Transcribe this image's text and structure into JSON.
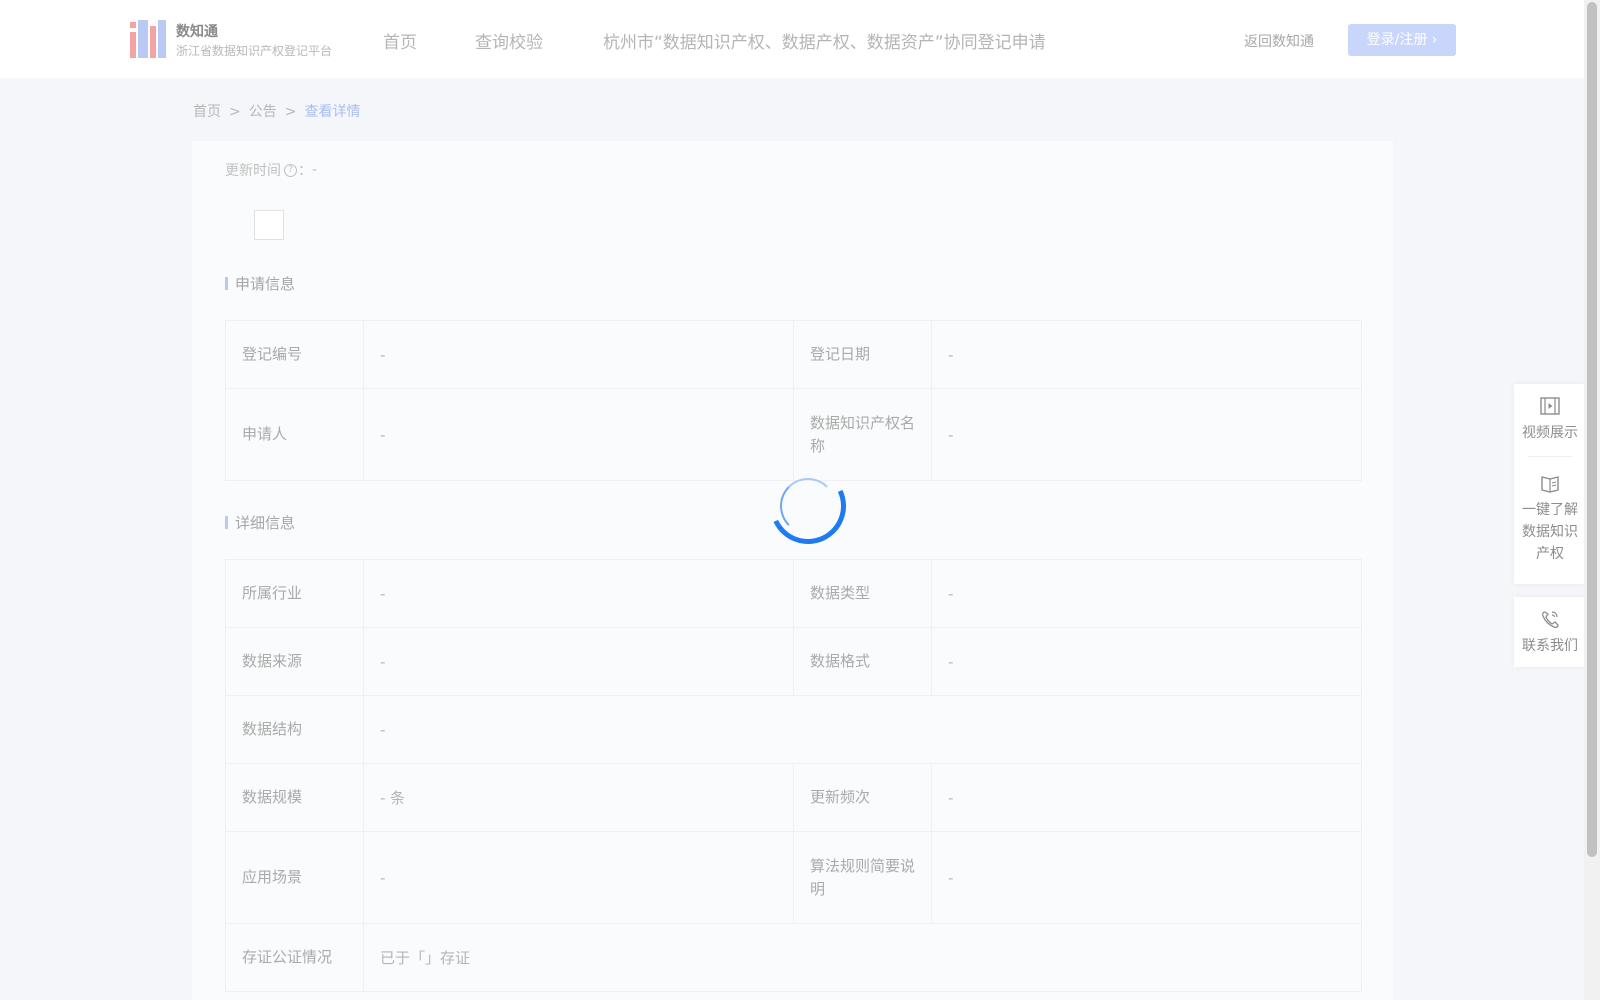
{
  "header": {
    "brand_name": "数知通",
    "brand_subtitle": "浙江省数据知识产权登记平台",
    "nav": [
      "首页",
      "查询校验",
      "杭州市“数据知识产权、数据产权、数据资产”协同登记申请"
    ],
    "back_link": "返回数知通",
    "login_button": "登录/注册",
    "login_arrow": "›"
  },
  "breadcrumb": {
    "items": [
      "首页",
      "公告",
      "查看详情"
    ],
    "separator": ">"
  },
  "detail": {
    "update_label": "更新时间",
    "help_glyph": "?",
    "update_colon": "：",
    "update_value": "-",
    "application_section": "申请信息",
    "application_rows": [
      {
        "l1": "登记编号",
        "v1": "-",
        "l2": "登记日期",
        "v2": "-"
      },
      {
        "l1": "申请人",
        "v1": "-",
        "l2": "数据知识产权名称",
        "v2": "-"
      }
    ],
    "detail_section": "详细信息",
    "detail_rows": [
      {
        "l1": "所属行业",
        "v1": "-",
        "l2": "数据类型",
        "v2": "-"
      },
      {
        "l1": "数据来源",
        "v1": "-",
        "l2": "数据格式",
        "v2": "-"
      },
      {
        "l1": "数据结构",
        "v1": "-"
      },
      {
        "l1": "数据规模",
        "v1": "- 条",
        "l2": "更新频次",
        "v2": "-"
      },
      {
        "l1": "应用场景",
        "v1": "-",
        "l2": "算法规则简要说明",
        "v2": "-"
      },
      {
        "l1": "存证公证情况",
        "v1": "已于「」存证"
      }
    ]
  },
  "side_panel": {
    "video": "视频展示",
    "learn": "一键了解数据知识产权",
    "contact": "联系我们"
  },
  "colors": {
    "accent": "#1e7cf0",
    "login_button_bg": "#c9d6fb",
    "page_bg": "#f4f6fa"
  }
}
